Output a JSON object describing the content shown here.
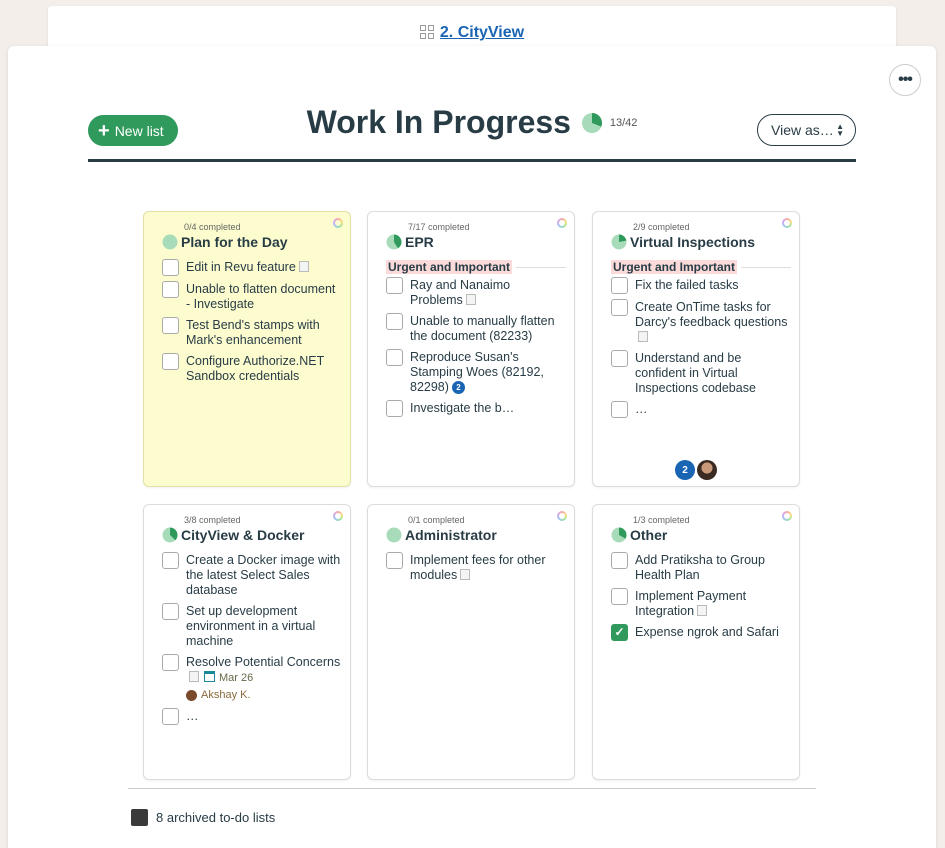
{
  "breadcrumb": {
    "project": "2. CityView"
  },
  "header": {
    "new_list_label": "New list",
    "title": "Work In Progress",
    "count": "13/42",
    "progress_fraction": 0.31,
    "view_as_label": "View as…"
  },
  "colors": {
    "accent_green": "#2f9a5c",
    "pie_green": "#2f9a5c",
    "pie_light": "#a8dbb9",
    "link_blue": "#1a64b4"
  },
  "lists": [
    {
      "completed": "0/4 completed",
      "name": "Plan for the Day",
      "progress_fraction": 0.0,
      "todos": [
        {
          "text": "Edit in Revu feature",
          "note": true
        },
        {
          "text": "Unable to flatten document - Investigate"
        },
        {
          "text": "Test Bend's stamps with Mark's enhancement"
        },
        {
          "text": "Configure Authorize.NET Sandbox credentials"
        }
      ]
    },
    {
      "completed": "7/17 completed",
      "name": "EPR",
      "progress_fraction": 0.41,
      "group": "Urgent and Important",
      "todos": [
        {
          "text": "Ray and Nanaimo Problems",
          "note": true
        },
        {
          "text": "Unable to manually flatten the document (82233)"
        },
        {
          "text": "Reproduce Susan's Stamping Woes (82192, 82298)",
          "comments": "2"
        },
        {
          "text": "Investigate the b…"
        }
      ]
    },
    {
      "completed": "2/9 completed",
      "name": "Virtual Inspections",
      "progress_fraction": 0.22,
      "group": "Urgent and Important",
      "todos": [
        {
          "text": "Fix the failed tasks"
        },
        {
          "text": "Create OnTime tasks for Darcy's feedback questions",
          "note": true
        },
        {
          "text": "Understand and be confident in Virtual Inspections codebase"
        },
        {
          "text": "…"
        }
      ],
      "footer_count": "2"
    },
    {
      "completed": "3/8 completed",
      "name": "CityView & Docker",
      "progress_fraction": 0.375,
      "todos": [
        {
          "text": "Create a Docker image with the latest Select Sales database"
        },
        {
          "text": "Set up development environment in a virtual machine"
        },
        {
          "text": "Resolve Potential Concerns",
          "note": true,
          "due": "Mar 26",
          "assignee": "Akshay K."
        },
        {
          "text": "…"
        }
      ]
    },
    {
      "completed": "0/1 completed",
      "name": "Administrator",
      "progress_fraction": 0.0,
      "todos": [
        {
          "text": "Implement fees for other modules",
          "note": true
        }
      ]
    },
    {
      "completed": "1/3 completed",
      "name": "Other",
      "progress_fraction": 0.33,
      "todos": [
        {
          "text": "Add Pratiksha to Group Health Plan"
        },
        {
          "text": "Implement Payment Integration",
          "note": true
        },
        {
          "text": "Expense ngrok and Safari",
          "checked": true
        }
      ]
    }
  ],
  "archived_label": "8 archived to-do lists"
}
